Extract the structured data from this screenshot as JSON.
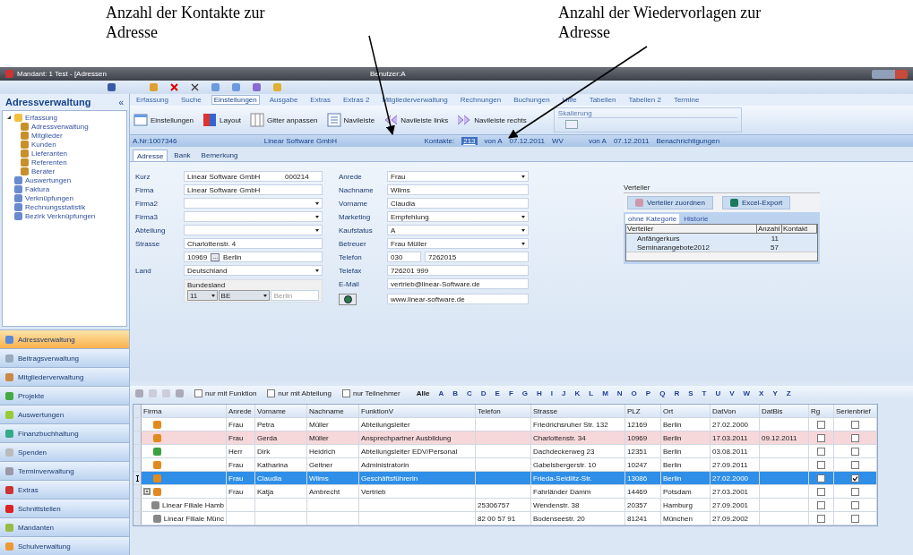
{
  "annotations": [
    {
      "text": "Anzahl der Kontakte zur Adresse"
    },
    {
      "text": "Anzahl der Wiedervorlagen zur Adresse"
    }
  ],
  "window": {
    "title": "Mandant: 1 Test - [Adressen",
    "user": "Benutzer:A"
  },
  "sidebar": {
    "title": "Adressverwaltung",
    "collapse": "«",
    "tree": [
      {
        "label": "Erfassung",
        "expanded": true,
        "children": [
          {
            "label": "Adressverwaltung"
          },
          {
            "label": "Mitglieder"
          },
          {
            "label": "Kunden"
          },
          {
            "label": "Lieferanten"
          },
          {
            "label": "Referenten"
          },
          {
            "label": "Berater"
          }
        ]
      },
      {
        "label": "Auswertungen"
      },
      {
        "label": "Faktura"
      },
      {
        "label": "Verknüpfungen"
      },
      {
        "label": "Rechnungsstatistik"
      },
      {
        "label": "Bezirk Verknüpfungen"
      }
    ],
    "nav": [
      {
        "label": "Adressverwaltung",
        "selected": true
      },
      {
        "label": "Beitragsverwaltung",
        "selected": false
      },
      {
        "label": "Mitgliederverwaltung",
        "selected": false
      },
      {
        "label": "Projekte",
        "selected": false
      },
      {
        "label": "Auswertungen",
        "selected": false
      },
      {
        "label": "Finanzbuchhaltung",
        "selected": false
      },
      {
        "label": "Spenden",
        "selected": false
      },
      {
        "label": "Terminverwaltung",
        "selected": false
      },
      {
        "label": "Extras",
        "selected": false
      },
      {
        "label": "Schnittstellen",
        "selected": false
      },
      {
        "label": "Mandanten",
        "selected": false
      },
      {
        "label": "Schulverwaltung",
        "selected": false
      }
    ]
  },
  "menu": [
    {
      "label": "Erfassung",
      "selected": false
    },
    {
      "label": "Suche",
      "selected": false
    },
    {
      "label": "Einstellungen",
      "selected": true
    },
    {
      "label": "Ausgabe",
      "selected": false
    },
    {
      "label": "Extras",
      "selected": false
    },
    {
      "label": "Extras 2",
      "selected": false
    },
    {
      "label": "Mitgliederverwaltung",
      "selected": false
    },
    {
      "label": "Rechnungen",
      "selected": false
    },
    {
      "label": "Buchungen",
      "selected": false
    },
    {
      "label": "Hilfe",
      "selected": false
    },
    {
      "label": "Tabellen",
      "selected": false
    },
    {
      "label": "Tabellen 2",
      "selected": false
    },
    {
      "label": "Termine",
      "selected": false
    }
  ],
  "ribbon": {
    "buttons": [
      {
        "label": "Einstellungen",
        "kind": "settings"
      },
      {
        "label": "Layout",
        "kind": "layout"
      },
      {
        "label": "Gitter anpassen",
        "kind": "grid"
      },
      {
        "label": "Navileiste",
        "kind": "bar"
      },
      {
        "label": "Navileiste links",
        "kind": "left"
      },
      {
        "label": "Navileiste rechts",
        "kind": "right"
      }
    ],
    "group": "Skalierung"
  },
  "info_bar": {
    "number": "A.Nr:1007346",
    "company": "Linear Software GmbH",
    "contacts_label": "Kontakte:",
    "contacts_count": "213",
    "contacts_by": "von A",
    "contacts_date": "07.12.2011",
    "wv_label": "WV",
    "wv_by": "von A",
    "wv_date": "07.12.2011",
    "notifications": "Benachrichtigungen"
  },
  "form": {
    "tabs": [
      {
        "label": "Adresse",
        "selected": true
      },
      {
        "label": "Bank",
        "selected": false
      },
      {
        "label": "Bemerkung",
        "selected": false
      }
    ],
    "left": [
      {
        "kind": "code",
        "label": "Kurz",
        "value": "Linear Software GmbH",
        "code": "000214"
      },
      {
        "kind": "text",
        "label": "Firma",
        "value": "Linear Software GmbH"
      },
      {
        "kind": "select",
        "label": "Firma2"
      },
      {
        "kind": "select",
        "label": "Firma3"
      },
      {
        "kind": "select",
        "label": "Abteilung"
      },
      {
        "kind": "text",
        "label": "Strasse",
        "value": "Charlottenstr. 4"
      },
      {
        "kind": "plz",
        "plz": "10969",
        "button": "...",
        "city": "Berlin"
      },
      {
        "kind": "select",
        "label": "Land",
        "value": "Deutschland"
      }
    ],
    "bundesland": {
      "title": "Bundesland",
      "number": "11",
      "code": "BE",
      "name": "Berlin"
    },
    "right": [
      {
        "kind": "select",
        "label": "Anrede",
        "value": "Frau"
      },
      {
        "kind": "text",
        "label": "Nachname",
        "value": "Wilms"
      },
      {
        "kind": "text",
        "label": "Vorname",
        "value": "Claudia"
      },
      {
        "kind": "select",
        "label": "Marketing",
        "value": "Empfehlung"
      },
      {
        "kind": "select",
        "label": "Kaufstatus",
        "value": "A"
      },
      {
        "kind": "select",
        "label": "Betreuer",
        "value": "Frau Müller"
      },
      {
        "kind": "phone",
        "label": "Telefon",
        "code": "030",
        "value": "7262015"
      },
      {
        "kind": "text",
        "label": "Telefax",
        "value": "726201 999"
      },
      {
        "kind": "text",
        "label": "E-Mail",
        "value": "vertrieb@linear-Software.de"
      },
      {
        "kind": "web",
        "value": "www.linear-software.de"
      }
    ]
  },
  "verteiler": {
    "title": "Verteiler",
    "buttons": [
      "Verteiler zuordnen",
      "Excel-Export"
    ],
    "tabs": [
      {
        "label": "ohne Kategorie",
        "selected": true
      },
      {
        "label": "Historie",
        "selected": false
      }
    ],
    "columns": [
      "Verteiler",
      "Anzahl",
      "Kontakt"
    ],
    "rows": [
      {
        "name": "Anfängerkurs",
        "count": "11"
      },
      {
        "name": "Seminarangebote2012",
        "count": "57"
      }
    ]
  },
  "grid_toolbar": {
    "filters": [
      {
        "label": "nur mit Funktion",
        "checked": false
      },
      {
        "label": "nur mit Abteilung",
        "checked": false
      },
      {
        "label": "nur Teilnehmer",
        "checked": false
      }
    ],
    "letters": [
      "Alle",
      "A",
      "B",
      "C",
      "D",
      "E",
      "F",
      "G",
      "H",
      "I",
      "J",
      "K",
      "L",
      "M",
      "N",
      "O",
      "P",
      "Q",
      "R",
      "S",
      "T",
      "U",
      "V",
      "W",
      "X",
      "Y",
      "Z"
    ]
  },
  "table": {
    "columns": [
      "Firma",
      "Anrede",
      "Vorname",
      "Nachname",
      "FunktionV",
      "Telefon",
      "Strasse",
      "PLZ",
      "Ort",
      "DatVon",
      "DatBis",
      "Rg",
      "Serienbrief"
    ],
    "rows": [
      {
        "kind": "female",
        "cells": [
          "",
          "Frau",
          "Petra",
          "Müller",
          "Abteilungsleiter",
          "",
          "Friedrichsruher Str. 132",
          "12169",
          "Berlin",
          "27.02.2000",
          ""
        ],
        "rg": false,
        "serienbrief": false,
        "selected": false,
        "highlighted": false,
        "expandable": false
      },
      {
        "kind": "female",
        "cells": [
          "",
          "Frau",
          "Gerda",
          "Müller",
          "Ansprechpartner Ausbildung",
          "",
          "Charlottenstr. 34",
          "10969",
          "Berlin",
          "17.03.2011",
          "09.12.2011"
        ],
        "rg": false,
        "serienbrief": false,
        "selected": false,
        "highlighted": true,
        "expandable": false
      },
      {
        "kind": "male",
        "cells": [
          "",
          "Herr",
          "Dirk",
          "Heidrich",
          "Abteilungsleiter EDV/Personal",
          "",
          "Dachdeckerweg 23",
          "12351",
          "Berlin",
          "03.08.2011",
          ""
        ],
        "rg": false,
        "serienbrief": false,
        "selected": false,
        "highlighted": false,
        "expandable": false
      },
      {
        "kind": "female",
        "cells": [
          "",
          "Frau",
          "Katharina",
          "Geitner",
          "Administratorin",
          "",
          "Gabelsbergerstr. 10",
          "10247",
          "Berlin",
          "27.09.2011",
          ""
        ],
        "rg": false,
        "serienbrief": false,
        "selected": false,
        "highlighted": false,
        "expandable": false
      },
      {
        "kind": "female",
        "cells": [
          "",
          "Frau",
          "Claudia",
          "Wilms",
          "Geschäftsführerin",
          "",
          "Frieda-Seidlitz-Str.",
          "13086",
          "Berlin",
          "27.02.2000",
          ""
        ],
        "rg": false,
        "serienbrief": true,
        "selected": true,
        "highlighted": false,
        "expandable": false
      },
      {
        "kind": "female",
        "cells": [
          "",
          "Frau",
          "Katja",
          "Ambrecht",
          "Vertrieb",
          "",
          "Fahrländer Damm",
          "14469",
          "Potsdam",
          "27.03.2001",
          ""
        ],
        "rg": false,
        "serienbrief": false,
        "selected": false,
        "highlighted": false,
        "expandable": true
      },
      {
        "kind": "branch",
        "cells": [
          "Linear Filiale Hamb",
          "",
          "",
          "",
          "",
          "25306757",
          "Wendenstr. 38",
          "20357",
          "Hamburg",
          "27.09.2001",
          ""
        ],
        "rg": false,
        "serienbrief": false,
        "selected": false,
        "highlighted": false,
        "expandable": false
      },
      {
        "kind": "branch",
        "cells": [
          "Linear Filiale Münc",
          "",
          "",
          "",
          "",
          "82 00 57 91",
          "Bodenseestr. 20",
          "81241",
          "München",
          "27.09.2002",
          ""
        ],
        "rg": false,
        "serienbrief": false,
        "selected": false,
        "highlighted": false,
        "expandable": false
      }
    ]
  }
}
